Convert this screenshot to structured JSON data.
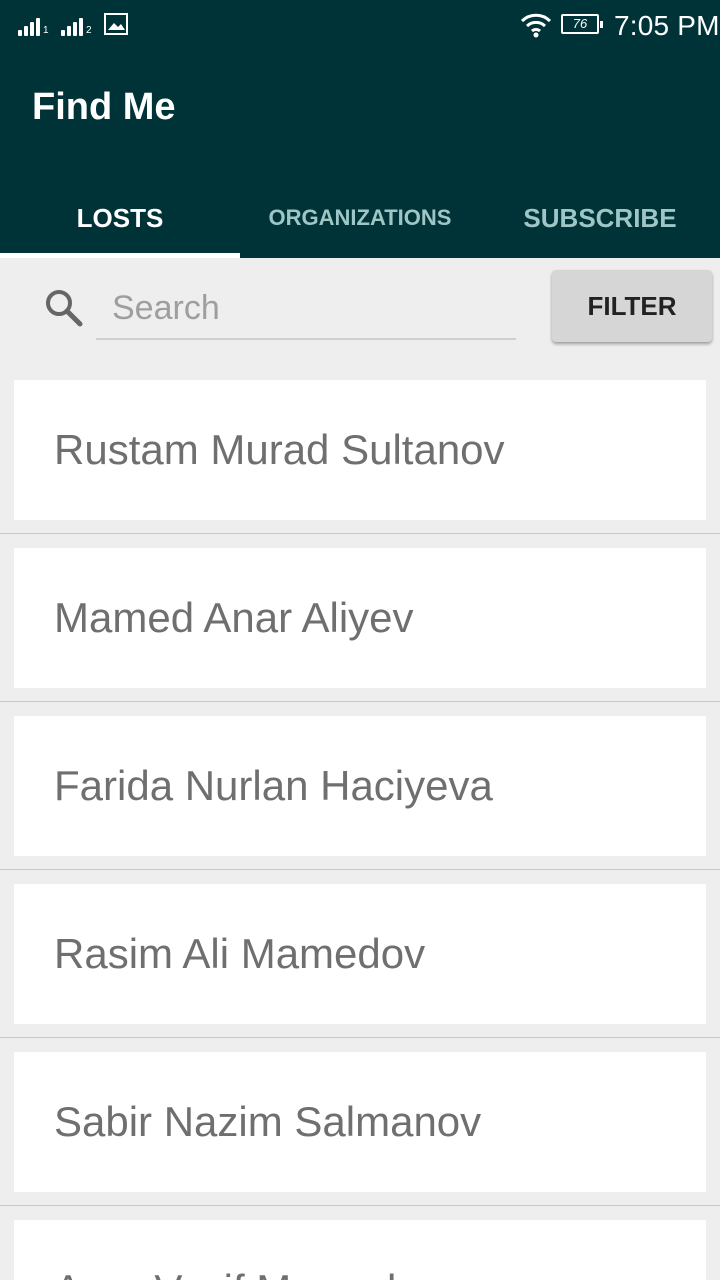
{
  "status_bar": {
    "sim1_sub": "1",
    "sim2_sub": "2",
    "battery": "76",
    "time": "7:05 PM",
    "icons": [
      "signal-sim1-icon",
      "signal-sim2-icon",
      "image-notification-icon",
      "wifi-icon",
      "battery-icon"
    ]
  },
  "app": {
    "title": "Find Me",
    "bar_color": "#003337"
  },
  "tabs": [
    {
      "label": "LOSTS",
      "active": true
    },
    {
      "label": "ORGANIZATIONS",
      "active": false
    },
    {
      "label": "SUBSCRIBE",
      "active": false
    }
  ],
  "search": {
    "placeholder": "Search",
    "value": "",
    "icon": "search-icon"
  },
  "filter_button": {
    "label": "FILTER"
  },
  "people": [
    {
      "name": "Rustam Murad Sultanov"
    },
    {
      "name": "Mamed Anar Aliyev"
    },
    {
      "name": "Farida Nurlan Haciyeva"
    },
    {
      "name": "Rasim Ali Mamedov"
    },
    {
      "name": "Sabir Nazim Salmanov"
    },
    {
      "name": "Anar Vasif Mamedov"
    }
  ]
}
